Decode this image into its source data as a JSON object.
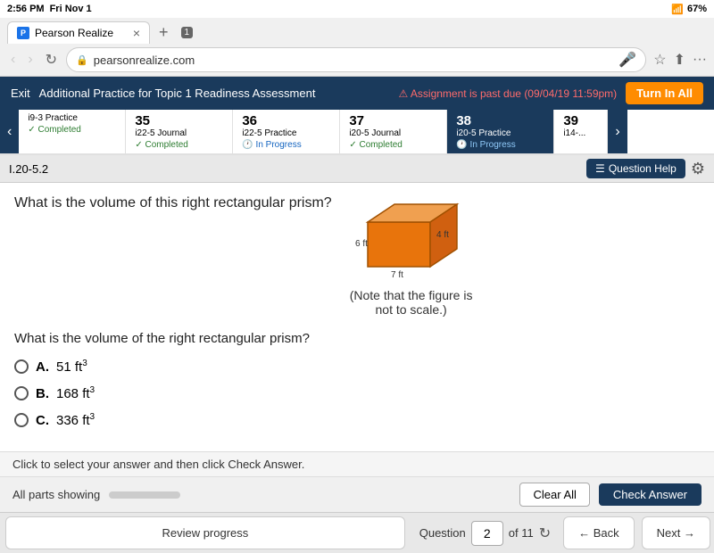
{
  "statusBar": {
    "time": "2:56 PM",
    "day": "Fri Nov 1",
    "wifi": "WiFi",
    "battery": "67%",
    "tabCount": "1"
  },
  "browser": {
    "tab": {
      "label": "Pearson Realize",
      "closeIcon": "×"
    },
    "address": "pearsonrealize.com",
    "backDisabled": true,
    "forwardDisabled": true
  },
  "appHeader": {
    "exitLabel": "Exit",
    "title": "Additional Practice for Topic 1 Readiness Assessment",
    "dueBadge": "⚠ Assignment is past due (09/04/19 11:59pm)",
    "turnInLabel": "Turn In All"
  },
  "tabs": [
    {
      "num": "",
      "label": "i9-3 Practice",
      "status": "Completed",
      "statusType": "completed"
    },
    {
      "num": "35",
      "label": "i22-5 Journal",
      "status": "Completed",
      "statusType": "completed"
    },
    {
      "num": "36",
      "label": "i22-5 Practice",
      "status": "In Progress",
      "statusType": "in-progress"
    },
    {
      "num": "37",
      "label": "i20-5 Journal",
      "status": "Completed",
      "statusType": "completed"
    },
    {
      "num": "38",
      "label": "i20-5 Practice",
      "status": "In Progress",
      "statusType": "active-in-progress",
      "active": true
    },
    {
      "num": "39",
      "label": "i14-...",
      "status": "",
      "statusType": ""
    }
  ],
  "questionBar": {
    "questionId": "I.20-5.2",
    "questionHelpLabel": "Question Help",
    "listIcon": "☰"
  },
  "question": {
    "mainText": "What is the volume of this right rectangular prism?",
    "figureNote": "(Note that the figure is\nnot to scale.)",
    "dimensions": {
      "width": "6 ft",
      "depth": "7 ft",
      "height": "4 ft"
    },
    "questionText": "What is the volume of the right rectangular prism?",
    "choices": [
      {
        "letter": "A.",
        "value": "51 ft",
        "sup": "3"
      },
      {
        "letter": "B.",
        "value": "168 ft",
        "sup": "3"
      },
      {
        "letter": "C.",
        "value": "336 ft",
        "sup": "3"
      }
    ]
  },
  "bottomBar": {
    "instruction": "Click to select your answer and then click Check Answer.",
    "partsLabel": "All parts showing",
    "clearAllLabel": "Clear All",
    "checkAnswerLabel": "Check Answer"
  },
  "footerNav": {
    "reviewProgressLabel": "Review progress",
    "questionLabel": "Question",
    "questionNum": "2",
    "questionOf": "of 11",
    "backLabel": "← Back",
    "nextLabel": "Next →"
  }
}
